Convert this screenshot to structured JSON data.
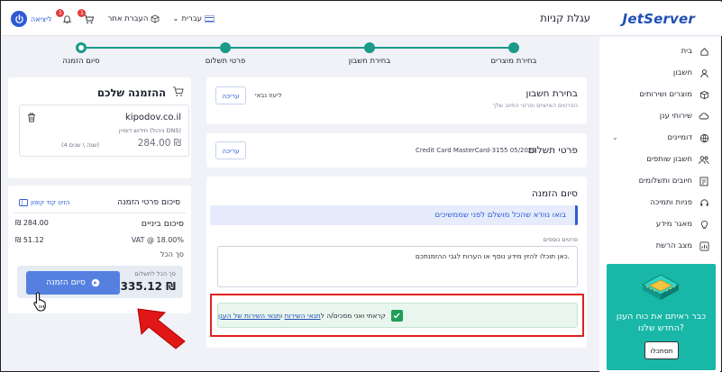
{
  "header": {
    "logo": "JetServer",
    "page_title": "עגלת קניות",
    "language": "עברית",
    "site_help": "העברת אתר",
    "logout": "ליציאה",
    "cart_badge": "1",
    "notif_badge": "1"
  },
  "sidebar": {
    "items": [
      {
        "label": "בית",
        "icon": "home-icon"
      },
      {
        "label": "חשבון",
        "icon": "user-icon"
      },
      {
        "label": "מוצרים ושירותים",
        "icon": "box-icon"
      },
      {
        "label": "שירותי ענן",
        "icon": "cloud-icon"
      },
      {
        "label": "דומיינים",
        "icon": "globe-icon"
      },
      {
        "label": "חשבון שותפים",
        "icon": "partners-icon"
      },
      {
        "label": "חיובים ותשלומים",
        "icon": "billing-icon"
      },
      {
        "label": "פניות ותמיכה",
        "icon": "support-icon"
      },
      {
        "label": "מאגר מידע",
        "icon": "knowledge-icon"
      },
      {
        "label": "מצב הרשת",
        "icon": "network-icon"
      }
    ],
    "promo": {
      "text_line1": "כבר ראיתם את כוח הענן",
      "text_line2": "החדש שלנו?",
      "button": "תסתכלו"
    }
  },
  "stepper": {
    "steps": [
      "בחירת מוצרים",
      "בחירת חשבון",
      "פרטי תשלום",
      "סיום הזמנה"
    ]
  },
  "account_card": {
    "title": "בחירת חשבון",
    "subtitle": "הפרטים האישיים ופרטי החיוב שלך",
    "value": "ליעוז נבאי",
    "edit": "עריכה"
  },
  "payment_card": {
    "title": "פרטי תשלום",
    "value": "Credit Card MasterCard-3155 05/2029",
    "edit": "עריכה"
  },
  "finish_card": {
    "title": "סיום הזמנה",
    "notice": "בואו נוודא שהכל מושלם לפני שממשיכים",
    "notes_label": "פרטים נוספים",
    "notes_text": "כאן תוכלו להזין מידע נוסף או הערות לגבי ההזמנתכם.",
    "terms_prefix": "קראתי ואני מסכים/ה ל",
    "terms_link1": "תנאי השירות",
    "terms_sep": " ו",
    "terms_link2": "תנאי השירות של הענן"
  },
  "order": {
    "title": "ההזמנה שלכם",
    "product_name": "kipodov.co.il",
    "product_desc": "חידוש דומיין (ניהול DNS)",
    "product_price": "284.00 ₪",
    "product_period": "(4 שנה \\ שנים)",
    "summary_title": "סיכום פרטי הזמנה",
    "coupon": "הזינו קוד קופון",
    "subtotal_label": "סיכום ביניים",
    "subtotal_value": "284.00 ₪",
    "vat_label": "VAT @ 18.00%",
    "vat_value": "51.12 ₪",
    "total_label": "סך הכל",
    "total_to_pay_label": "סך הכל לתשלום",
    "total_to_pay": "335.12 ₪",
    "pay_button": "סיום הזמנה"
  },
  "colors": {
    "accent": "#2d5bd6",
    "teal": "#1a9a8a",
    "promo": "#18b7a7",
    "alert": "#e02020"
  }
}
